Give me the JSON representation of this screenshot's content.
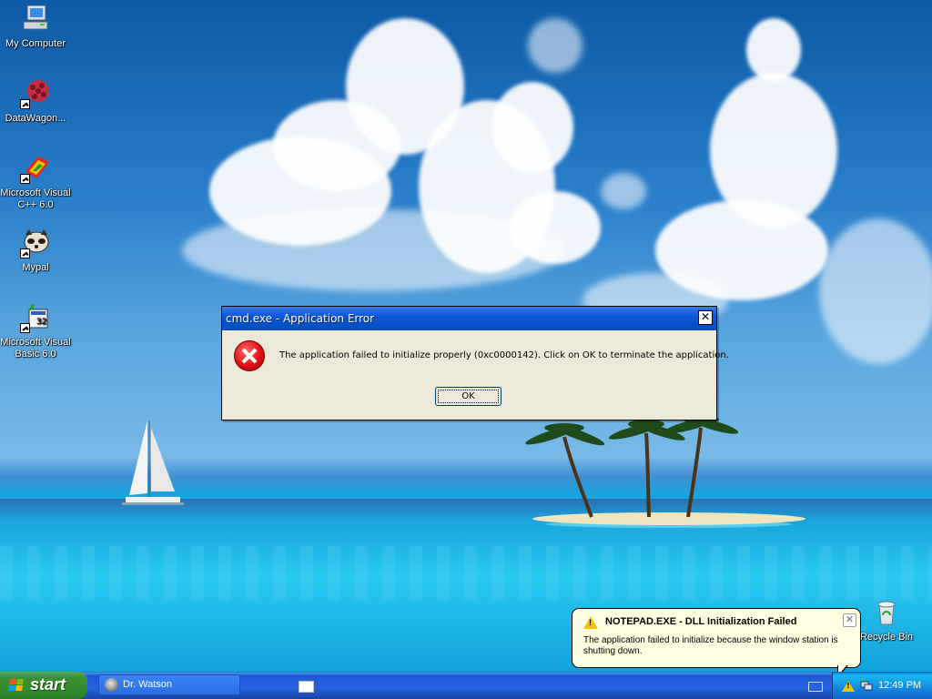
{
  "desktop": {
    "icons": [
      {
        "label": "My Computer"
      },
      {
        "label": "DataWagon..."
      },
      {
        "label": "Microsoft Visual C++ 6.0"
      },
      {
        "label": "Mypal"
      },
      {
        "label": "Microsoft Visual Basic 6.0"
      },
      {
        "label": "Recycle Bin"
      }
    ]
  },
  "dialog": {
    "title": "cmd.exe - Application Error",
    "close_glyph": "✕",
    "message": "The application failed to initialize properly (0xc0000142). Click on OK to terminate the application.",
    "ok_label": "OK",
    "icon": "error-icon"
  },
  "balloon": {
    "title": "NOTEPAD.EXE - DLL Initialization Failed",
    "message": "The application failed to initialize because the window station is shutting down.",
    "close_glyph": "✕",
    "icon": "warning-icon"
  },
  "taskbar": {
    "start_label": "start",
    "task_label": "Dr. Watson",
    "clock": "12:49 PM"
  },
  "colors": {
    "taskbar_blue": "#2663e0",
    "start_green": "#318a2c",
    "title_blue": "#0351c8",
    "dialog_bg": "#ece9d8",
    "balloon_bg": "#ffffe1"
  }
}
